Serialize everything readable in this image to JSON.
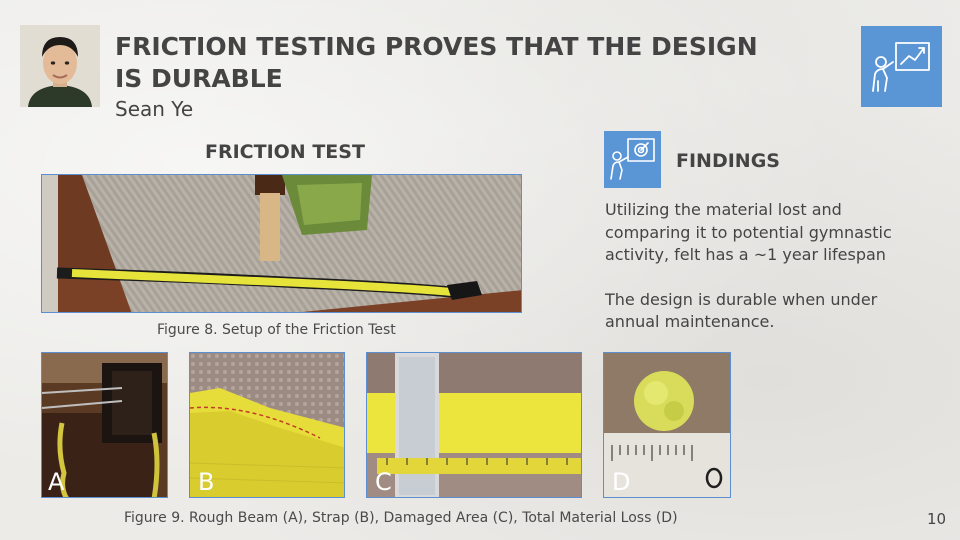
{
  "header": {
    "title_line1": "FRICTION TESTING PROVES THAT THE DESIGN",
    "title_line2": "IS DURABLE",
    "author": "Sean Ye"
  },
  "friction_test": {
    "heading": "FRICTION TEST",
    "figure8_caption": "Figure 8. Setup of the Friction Test"
  },
  "findings": {
    "heading": "FINDINGS",
    "paragraph1": "Utilizing the material lost and comparing it to potential gymnastic activity, felt has a ~1 year lifespan",
    "paragraph2": "The design is durable when under annual maintenance."
  },
  "figure9": {
    "caption": "Figure 9. Rough Beam (A), Strap (B), Damaged Area (C), Total Material Loss (D)",
    "labels": [
      "A",
      "B",
      "C",
      "D"
    ]
  },
  "page_number": "10",
  "colors": {
    "accent_blue": "#5a95d6",
    "title": "#444444",
    "background": "#ecebe8"
  },
  "icons": {
    "top_right": "presentation-chart-icon",
    "findings": "presenter-target-icon"
  }
}
